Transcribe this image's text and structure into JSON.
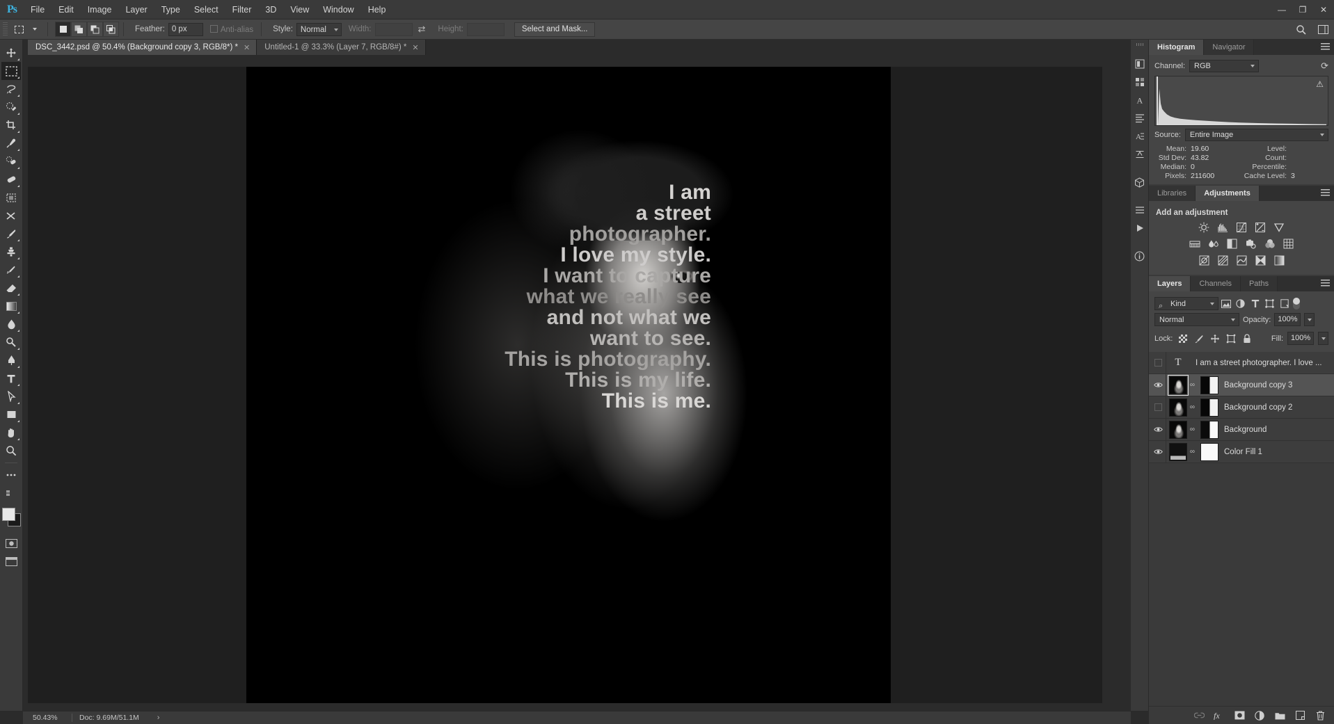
{
  "app": {
    "title": "Adobe Photoshop",
    "logo": "Ps"
  },
  "menubar": {
    "items": [
      "File",
      "Edit",
      "Image",
      "Layer",
      "Type",
      "Select",
      "Filter",
      "3D",
      "View",
      "Window",
      "Help"
    ],
    "window_controls": {
      "minimize": "—",
      "restore": "❐",
      "close": "✕"
    }
  },
  "options_bar": {
    "tool_icon": "rectangular-marquee-icon",
    "selection_modes": [
      "new-selection",
      "add-to-selection",
      "subtract-from-selection",
      "intersect-with-selection"
    ],
    "feather_label": "Feather:",
    "feather_value": "0 px",
    "antialias_label": "Anti-alias",
    "antialias_checked": false,
    "style_label": "Style:",
    "style_value": "Normal",
    "width_label": "Width:",
    "width_value": "",
    "swap_icon": "swap-dimensions-icon",
    "height_label": "Height:",
    "height_value": "",
    "select_and_mask": "Select and Mask...",
    "right_icons": [
      "search-icon",
      "workspace-icon"
    ]
  },
  "tabs": [
    {
      "label": "DSC_3442.psd @ 50.4% (Background copy 3, RGB/8*) *",
      "close": "✕",
      "active": true
    },
    {
      "label": "Untitled-1 @ 33.3% (Layer 7, RGB/8#) *",
      "close": "✕",
      "active": false
    }
  ],
  "toolbar": {
    "tools": [
      {
        "name": "move-tool",
        "has_flyout": true,
        "active": false
      },
      {
        "name": "rectangular-marquee-tool",
        "has_flyout": true,
        "active": true
      },
      {
        "name": "lasso-tool",
        "has_flyout": true,
        "active": false
      },
      {
        "name": "quick-selection-tool",
        "has_flyout": true,
        "active": false
      },
      {
        "name": "crop-tool",
        "has_flyout": true,
        "active": false
      },
      {
        "name": "eyedropper-tool",
        "has_flyout": true,
        "active": false
      },
      {
        "name": "spot-healing-brush-tool",
        "has_flyout": true,
        "active": false
      },
      {
        "name": "patch-tool",
        "has_flyout": true,
        "active": false
      },
      {
        "name": "frame-tool",
        "has_flyout": false,
        "active": false
      },
      {
        "name": "shuffle-tool",
        "has_flyout": false,
        "active": false
      },
      {
        "name": "brush-tool",
        "has_flyout": true,
        "active": false
      },
      {
        "name": "clone-stamp-tool",
        "has_flyout": true,
        "active": false
      },
      {
        "name": "history-brush-tool",
        "has_flyout": true,
        "active": false
      },
      {
        "name": "eraser-tool",
        "has_flyout": true,
        "active": false
      },
      {
        "name": "gradient-tool",
        "has_flyout": true,
        "active": false
      },
      {
        "name": "blur-tool",
        "has_flyout": true,
        "active": false
      },
      {
        "name": "dodge-tool",
        "has_flyout": true,
        "active": false
      },
      {
        "name": "pen-tool",
        "has_flyout": true,
        "active": false
      },
      {
        "name": "type-tool",
        "has_flyout": true,
        "active": false
      },
      {
        "name": "path-selection-tool",
        "has_flyout": true,
        "active": false
      },
      {
        "name": "rectangle-tool",
        "has_flyout": true,
        "active": false
      },
      {
        "name": "hand-tool",
        "has_flyout": true,
        "active": false
      },
      {
        "name": "zoom-tool",
        "has_flyout": false,
        "active": false
      },
      {
        "name": "more-tools-icon",
        "has_flyout": false,
        "active": false
      }
    ],
    "foreground_color": "#e8e8e8",
    "background_color": "#1a1a1a"
  },
  "canvas": {
    "poem_lines": [
      "I am",
      "a street",
      "photographer.",
      "I love my style.",
      "I want to capture",
      "what we really see",
      "and not what we",
      "want to see.",
      "This is photography.",
      "This is my life.",
      "This is me."
    ]
  },
  "status_bar": {
    "zoom": "50.43%",
    "doc": "Doc: 9.69M/51.1M",
    "expand_icon": "›"
  },
  "mini_dock": {
    "icons": [
      "color-icon",
      "swatches-icon",
      "character-icon",
      "paragraph-icon",
      "paragraph-styles-icon",
      "3d-icon",
      "actions-icon",
      "play-icon",
      "info-icon"
    ]
  },
  "histogram_panel": {
    "tabs": [
      {
        "label": "Histogram",
        "active": true
      },
      {
        "label": "Navigator",
        "active": false
      }
    ],
    "menu_icon": "panel-menu-icon",
    "channel_label": "Channel:",
    "channel_value": "RGB",
    "refresh_icon": "refresh-icon",
    "warning_icon": "cached-data-warning-icon",
    "source_label": "Source:",
    "source_value": "Entire Image",
    "stats": [
      {
        "key": "Mean:",
        "value": "19.60",
        "key2": "Level:",
        "value2": ""
      },
      {
        "key": "Std Dev:",
        "value": "43.82",
        "key2": "Count:",
        "value2": ""
      },
      {
        "key": "Median:",
        "value": "0",
        "key2": "Percentile:",
        "value2": ""
      },
      {
        "key": "Pixels:",
        "value": "211600",
        "key2": "Cache Level:",
        "value2": "3"
      }
    ]
  },
  "adjustments_panel": {
    "tabs": [
      {
        "label": "Libraries",
        "active": false
      },
      {
        "label": "Adjustments",
        "active": true
      }
    ],
    "menu_icon": "panel-menu-icon",
    "title": "Add an adjustment",
    "icons_row1": [
      "brightness-contrast-icon",
      "levels-icon",
      "curves-icon",
      "exposure-icon",
      "vibrance-icon"
    ],
    "icons_row2": [
      "hue-saturation-icon",
      "color-balance-icon",
      "black-white-icon",
      "photo-filter-icon",
      "channel-mixer-icon",
      "color-lookup-icon"
    ],
    "icons_row3": [
      "invert-icon",
      "posterize-icon",
      "threshold-icon",
      "selective-color-icon",
      "gradient-map-icon"
    ]
  },
  "layers_panel": {
    "tabs": [
      {
        "label": "Layers",
        "active": true
      },
      {
        "label": "Channels",
        "active": false
      },
      {
        "label": "Paths",
        "active": false
      }
    ],
    "menu_icon": "panel-menu-icon",
    "filter_kind": "Kind",
    "filter_icons": [
      "filter-pixel-icon",
      "filter-adjustment-icon",
      "filter-type-icon",
      "filter-shape-icon",
      "filter-smart-object-icon"
    ],
    "filter_toggle": "filter-enable-toggle",
    "blend_mode": "Normal",
    "opacity_label": "Opacity:",
    "opacity_value": "100%",
    "lock_label": "Lock:",
    "lock_icons": [
      "lock-transparent-pixels-icon",
      "lock-image-pixels-icon",
      "lock-position-icon",
      "lock-artboard-icon",
      "lock-all-icon"
    ],
    "fill_label": "Fill:",
    "fill_value": "100%",
    "layers": [
      {
        "name": "I am a street photographer. I love ...",
        "type": "text",
        "visible": false,
        "selected": false,
        "thumb": "type-T-icon"
      },
      {
        "name": "Background copy 3",
        "type": "pixel",
        "visible": true,
        "selected": true,
        "thumb": "face-thumbnail",
        "mask": "layer-mask-thumbnail",
        "linked": true
      },
      {
        "name": "Background copy 2",
        "type": "pixel",
        "visible": false,
        "selected": false,
        "thumb": "face-thumbnail",
        "mask": "layer-mask-thumbnail",
        "linked": true
      },
      {
        "name": "Background",
        "type": "pixel",
        "visible": true,
        "selected": false,
        "thumb": "face-thumbnail",
        "mask": "layer-mask-thumbnail",
        "linked": true
      },
      {
        "name": "Color Fill 1",
        "type": "fill",
        "visible": true,
        "selected": false,
        "thumb": "color-fill-thumbnail",
        "mask": "white-mask-thumbnail",
        "linked": true
      }
    ],
    "bottom_icons": [
      "link-layers-icon",
      "layer-style-fx-icon",
      "add-layer-mask-icon",
      "new-adjustment-layer-icon",
      "new-group-icon",
      "new-layer-icon",
      "delete-layer-icon"
    ]
  },
  "colors": {
    "accent": "#3db3e0",
    "panel_bg": "#454545",
    "chrome_bg": "#3a3a3a",
    "canvas_bg": "#1f1f1f",
    "selected_row": "#545454"
  }
}
